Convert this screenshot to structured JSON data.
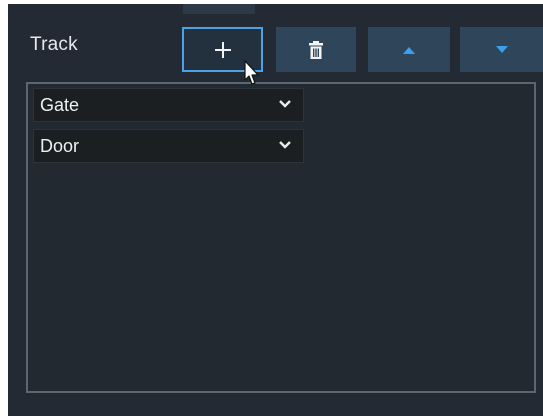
{
  "track_label": "Track",
  "buttons": {
    "add": {
      "icon": "plus-icon",
      "state": "focused"
    },
    "delete": {
      "icon": "trash-icon"
    },
    "move_up": {
      "icon": "arrow-up-icon"
    },
    "move_down": {
      "icon": "arrow-down-icon"
    }
  },
  "track_items": [
    {
      "value": "Gate"
    },
    {
      "value": "Door"
    }
  ],
  "colors": {
    "panel_bg": "#232a33",
    "button_bg": "#2f4559",
    "accent": "#4aa3e6",
    "dropdown_bg": "#1b1f21",
    "text": "#eef0f2"
  }
}
